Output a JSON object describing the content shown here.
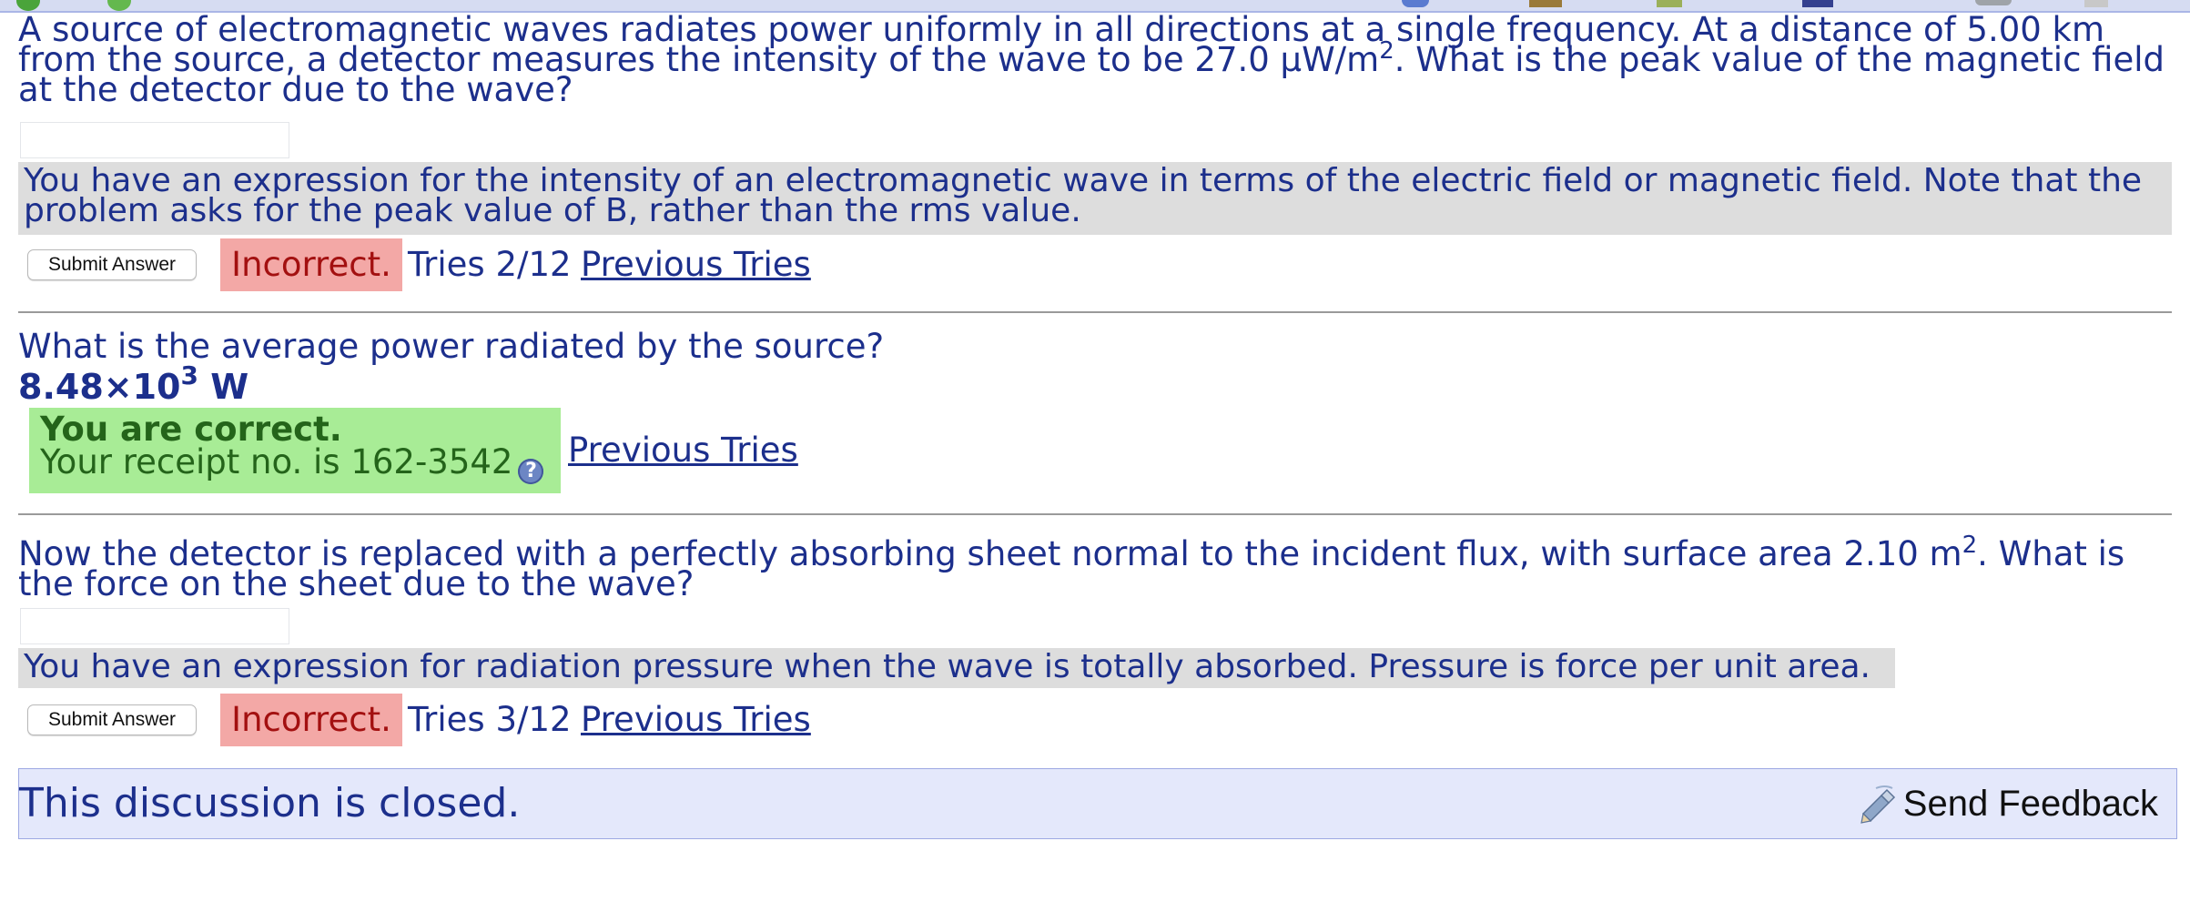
{
  "part1": {
    "question_before": "A source of electromagnetic waves radiates power uniformly in all directions at a single frequency. At a distance of 5.00 km from the source, a detector measures the intensity of the wave to be 27.0 μW/m",
    "question_sup": "2",
    "question_after": ". What is the peak value of the magnetic field at the detector due to the wave?",
    "input_value": "",
    "hint": "You have an expression for the intensity of an electromagnetic wave in terms of the electric field or magnetic field. Note that the problem asks for the peak value of B, rather than the rms value.",
    "submit_label": "Submit Answer",
    "status": "Incorrect.",
    "tries": "Tries 2/12",
    "previous_tries": "Previous Tries"
  },
  "part2": {
    "question": "What is the average power radiated by the source?",
    "answer_mantissa": "8.48×10",
    "answer_exponent": "3",
    "answer_unit": " W",
    "correct_title": "You are correct.",
    "receipt": "Your receipt no. is 162-3542",
    "help_icon": "question-mark-icon",
    "previous_tries": "Previous Tries"
  },
  "part3": {
    "question_before": "Now the detector is replaced with a perfectly absorbing sheet normal to the incident flux, with surface area 2.10 m",
    "question_sup": "2",
    "question_after": ". What is the force on the sheet due to the wave?",
    "input_value": "",
    "hint": "You have an expression for radiation pressure when the wave is totally absorbed. Pressure is force per unit area.",
    "submit_label": "Submit Answer",
    "status": "Incorrect.",
    "tries": "Tries 3/12",
    "previous_tries": "Previous Tries"
  },
  "discussion": {
    "text": "This discussion is closed.",
    "feedback_label": "Send Feedback",
    "feedback_icon": "pencil-paper-icon"
  },
  "colors": {
    "text": "#1c2f8c",
    "hint_bg": "#dddddd",
    "incorrect_bg": "#f3a8a6",
    "incorrect_text": "#a31010",
    "correct_bg": "#a8ec96",
    "correct_text": "#24641a",
    "discussion_bg": "#e4e8fb"
  }
}
